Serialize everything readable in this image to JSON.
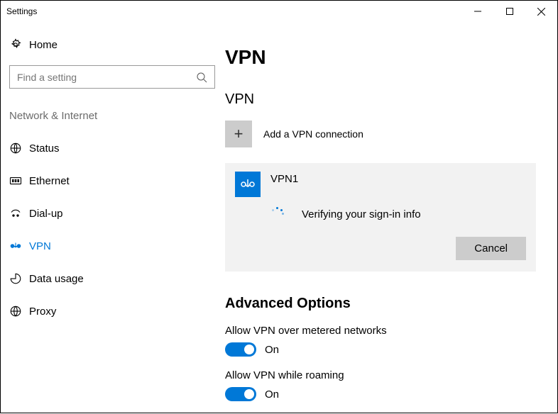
{
  "window": {
    "title": "Settings"
  },
  "sidebar": {
    "home_label": "Home",
    "search_placeholder": "Find a setting",
    "category_label": "Network & Internet",
    "items": [
      {
        "label": "Status"
      },
      {
        "label": "Ethernet"
      },
      {
        "label": "Dial-up"
      },
      {
        "label": "VPN"
      },
      {
        "label": "Data usage"
      },
      {
        "label": "Proxy"
      }
    ]
  },
  "main": {
    "page_title": "VPN",
    "vpn_section_title": "VPN",
    "add_vpn_label": "Add a VPN connection",
    "vpn_card": {
      "name": "VPN1",
      "status": "Verifying your sign-in info",
      "cancel_label": "Cancel"
    },
    "advanced_title": "Advanced Options",
    "toggles": [
      {
        "label": "Allow VPN over metered networks",
        "state": "On"
      },
      {
        "label": "Allow VPN while roaming",
        "state": "On"
      }
    ]
  }
}
